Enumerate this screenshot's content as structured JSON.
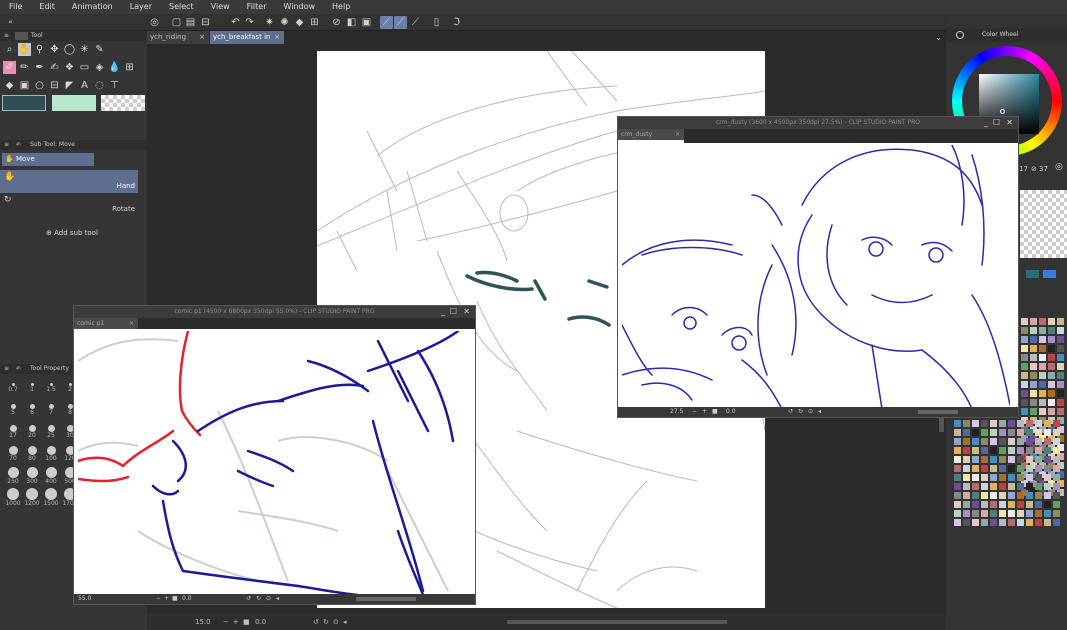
{
  "menu": [
    "File",
    "Edit",
    "Animation",
    "Layer",
    "Select",
    "View",
    "Filter",
    "Window",
    "Help"
  ],
  "tabs": [
    {
      "label": "ych_riding",
      "active": false
    },
    {
      "label": "ych_breakfast in bed",
      "active": true
    }
  ],
  "tool_panel": {
    "title": "Tool"
  },
  "sub_tool_panel": {
    "title": "Sub Tool: Move",
    "group": "Move",
    "items": [
      {
        "label": "Hand",
        "selected": true
      },
      {
        "label": "Rotate",
        "selected": false
      }
    ],
    "add_label": "Add sub tool"
  },
  "brush_size_panel": {
    "title": "Tool Property",
    "sizes": [
      "0.7",
      "1",
      "1.5",
      "2",
      "5",
      "6",
      "7",
      "8",
      "17",
      "20",
      "25",
      "30",
      "70",
      "80",
      "100",
      "120",
      "250",
      "300",
      "400",
      "500",
      "1000",
      "1200",
      "1500",
      "1700"
    ]
  },
  "color_wheel": {
    "title": "Color Wheel",
    "readout_left": "17",
    "readout_right": "37"
  },
  "windows": {
    "comic": {
      "title": "comic p1 (4500 x 6800px 350dpi 55.0%)  - CLIP STUDIO PAINT PRO",
      "tab": "comic p1",
      "zoom": "55.0",
      "rotation": "0.0"
    },
    "crm": {
      "title": "crm_dusty (3600 x 4500px 350dpi 27.5%)  - CLIP STUDIO PAINT PRO",
      "tab": "crm_dusty",
      "zoom": "27.5",
      "rotation": "0.0"
    }
  },
  "main_status": {
    "zoom": "15.0",
    "rotation": "0.0"
  },
  "colors": {
    "accent": "#5d6e8f",
    "line_blue": "#1a1a9a",
    "line_red": "#e8202a",
    "teal_line": "#2e5458"
  }
}
